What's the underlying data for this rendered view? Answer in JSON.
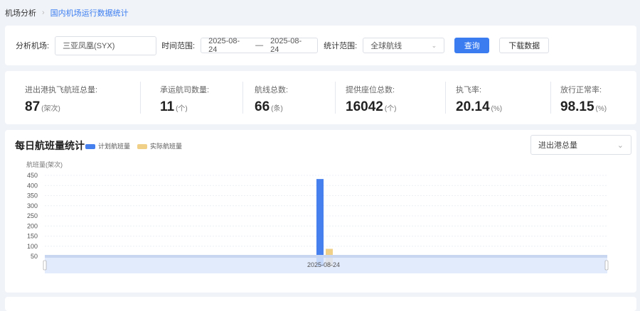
{
  "breadcrumb": {
    "parent": "机场分析",
    "current": "国内机场运行数据统计"
  },
  "filter": {
    "airport_label": "分析机场:",
    "airport_value": "三亚凤凰(SYX)",
    "time_label": "时间范围:",
    "date_start": "2025-08-24",
    "date_sep": "—",
    "date_end": "2025-08-24",
    "scope_label": "统计范围:",
    "scope_value": "全球航线",
    "query": "查询",
    "download": "下载数据"
  },
  "stats": [
    {
      "title": "进出港执飞航班总量:",
      "value": "87",
      "unit": "(架次)"
    },
    {
      "title": "承运航司数量:",
      "value": "11",
      "unit": "(个)"
    },
    {
      "title": "航线总数:",
      "value": "66",
      "unit": "(条)"
    },
    {
      "title": "提供座位总数:",
      "value": "16042",
      "unit": "(个)"
    },
    {
      "title": "执飞率:",
      "value": "20.14",
      "unit": "(%)"
    },
    {
      "title": "放行正常率:",
      "value": "98.15",
      "unit": "(%)"
    }
  ],
  "chart_select": "进出港总量",
  "chart_data": {
    "type": "bar",
    "title": "每日航班量统计",
    "ylabel": "航班量(架次)",
    "categories": [
      "2025-08-24"
    ],
    "series": [
      {
        "name": "计划航班量",
        "values": [
          432
        ],
        "color": "#4580ee"
      },
      {
        "name": "实际航班量",
        "values": [
          87
        ],
        "color": "#f0cf86"
      }
    ],
    "yticks": [
      "50",
      "100",
      "150",
      "200",
      "250",
      "300",
      "350",
      "400",
      "450"
    ],
    "ylim": [
      0,
      450
    ]
  }
}
